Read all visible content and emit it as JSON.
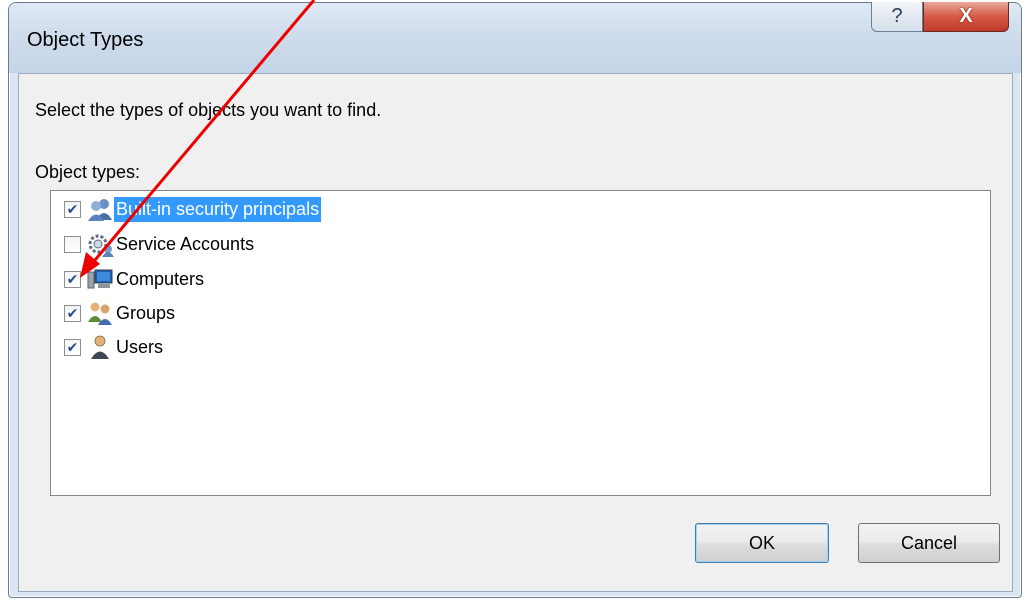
{
  "window": {
    "title": "Object Types",
    "help_glyph": "?",
    "close_glyph": "X"
  },
  "dialog": {
    "instruction": "Select the types of objects you want to find.",
    "list_label": "Object types:"
  },
  "object_types": [
    {
      "label": "Built-in security principals",
      "checked": true,
      "selected": true,
      "icon": "security-principals-icon"
    },
    {
      "label": "Service Accounts",
      "checked": false,
      "selected": false,
      "icon": "service-accounts-icon"
    },
    {
      "label": "Computers",
      "checked": true,
      "selected": false,
      "icon": "computer-icon"
    },
    {
      "label": "Groups",
      "checked": true,
      "selected": false,
      "icon": "groups-icon"
    },
    {
      "label": "Users",
      "checked": true,
      "selected": false,
      "icon": "user-icon"
    }
  ],
  "buttons": {
    "ok": "OK",
    "cancel": "Cancel"
  },
  "annotation": {
    "arrow_color": "#ee0000"
  },
  "colors": {
    "selection": "#3399ff",
    "close_button": "#c0392b"
  }
}
